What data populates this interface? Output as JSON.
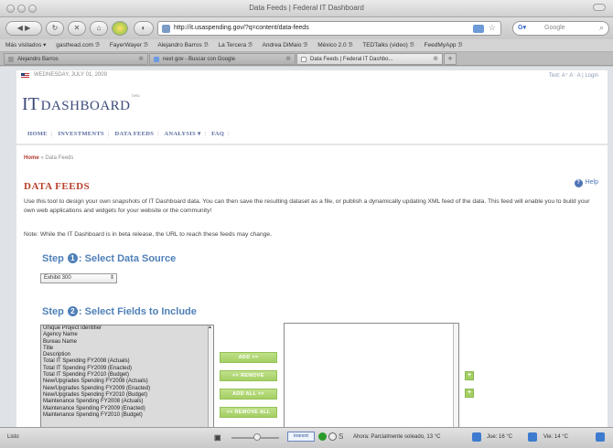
{
  "window": {
    "title": "Data Feeds | Federal IT Dashboard"
  },
  "toolbar": {
    "url": "http://it.usaspending.gov/?q=content/data-feeds",
    "search_placeholder": "Google"
  },
  "bookmarks": [
    "Más visitados ▾",
    "gasthead.com ℬ",
    "FayerWayer ℬ",
    "Alejandro Barros ℬ",
    "La Tercera ℬ",
    "Andrea DiMaio ℬ",
    "México 2.0 ℬ",
    "TEDTalks (video) ℬ",
    "FeedMyApp ℬ"
  ],
  "tabs": [
    {
      "label": "Alejandro Barros"
    },
    {
      "label": "next gov - Buscar con Google"
    },
    {
      "label": "Data Feeds | Federal IT Dashbo..."
    }
  ],
  "page": {
    "date": "WEDNESDAY, JULY 01, 2009",
    "top_links": "Text: A⁺ A⁻ A | Login",
    "logo_it": "IT",
    "logo_dashboard": "DASHBOARD",
    "logo_beta": "beta",
    "nav": [
      "HOME",
      "INVESTMENTS",
      "DATA FEEDS",
      "ANALYSIS ▾",
      "FAQ"
    ],
    "breadcrumb_home": "Home",
    "breadcrumb_current": "» Data Feeds",
    "title": "DATA FEEDS",
    "help": "Help",
    "description": "Use this tool to design your own snapshots of IT Dashboard data. You can then save the resulting dataset as a file, or publish a dynamically updating XML feed of the data. This feed will enable you to build your own web applications and widgets for your website or the community!",
    "note": "Note: While the IT Dashboard is in beta release, the URL to reach these feeds may change.",
    "step1": {
      "prefix": "Step",
      "num": "1",
      "label": ": Select Data Source"
    },
    "data_source": "Exhibit 300",
    "step2": {
      "prefix": "Step",
      "num": "2",
      "label": ": Select Fields to Include"
    },
    "fields": [
      "Unique Project Identifier",
      "Agency Name",
      "Bureau Name",
      "Title",
      "Description",
      "Total IT Spending FY2008 (Actuals)",
      "Total IT Spending FY2009 (Enacted)",
      "Total IT Spending FY2010 (Budget)",
      "New/Upgrades Spending FY2008 (Actuals)",
      "New/Upgrades Spending FY2009 (Enacted)",
      "New/Upgrades Spending FY2010 (Budget)",
      "Maintenance Spending FY2008 (Actuals)",
      "Maintenance Spending FY2009 (Enacted)",
      "Maintenance Spending FY2010 (Budget)"
    ],
    "buttons": {
      "add": "ADD >>",
      "remove": "<< REMOVE",
      "add_all": "ADD ALL >>",
      "remove_all": "<< REMOVE ALL",
      "move_up": "+",
      "move_down": "+"
    }
  },
  "statusbar": {
    "status": "Listo",
    "counter": "iniexnt",
    "s_label": "S",
    "weather1": "Ahora: Parcialmente soleado, 13 °C",
    "weather2": "Jue: 16 °C",
    "weather3": "Vie: 14 °C"
  }
}
